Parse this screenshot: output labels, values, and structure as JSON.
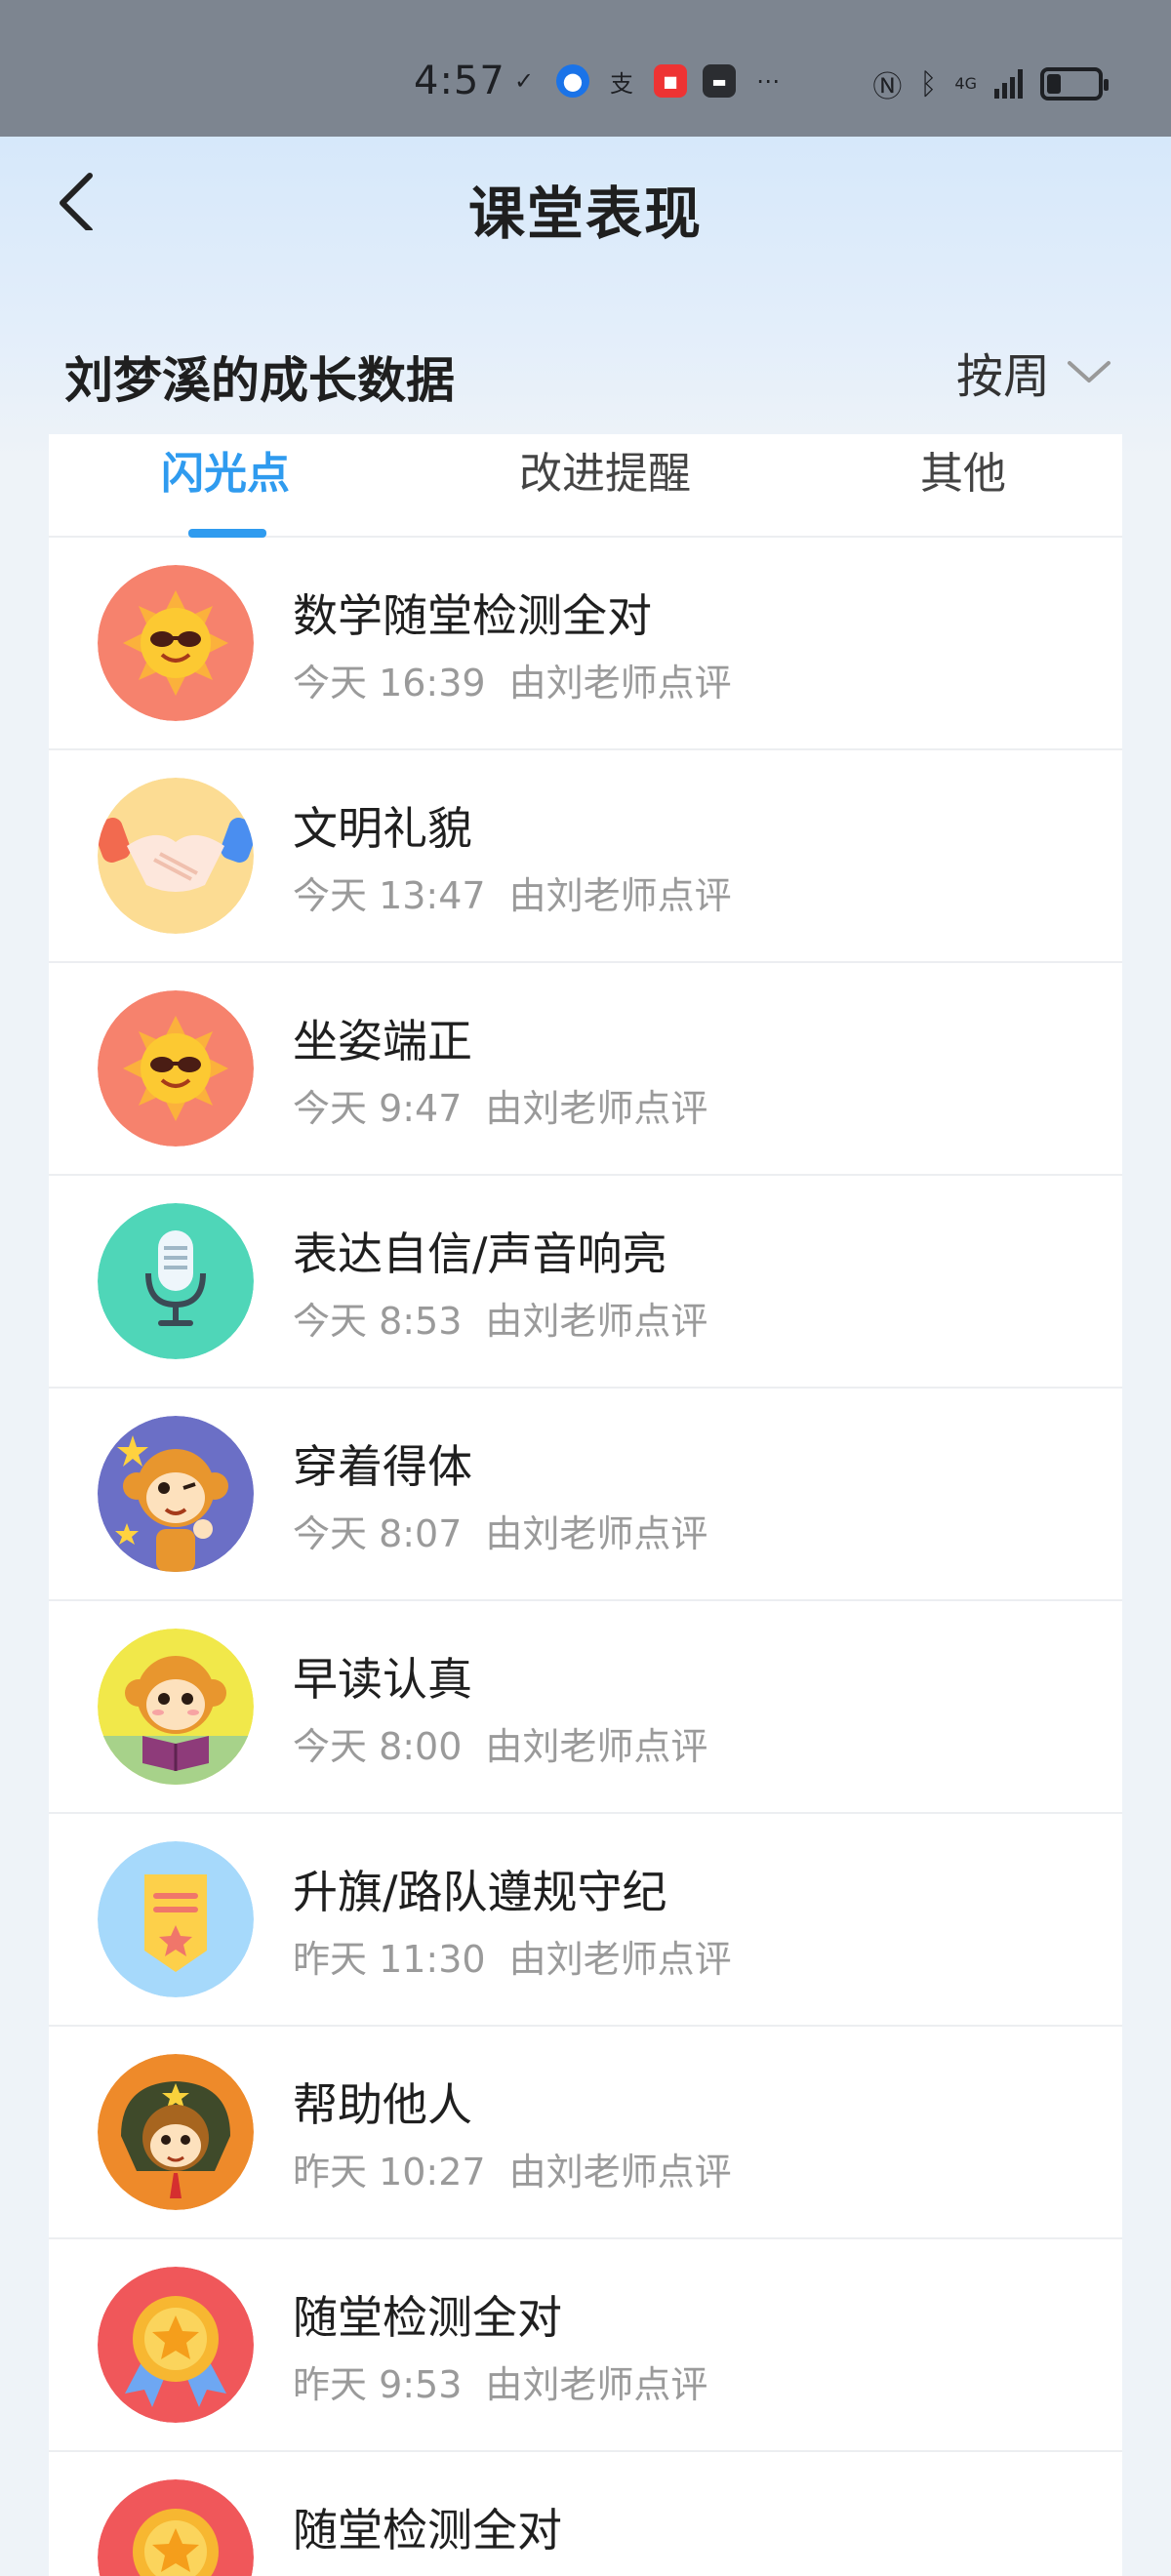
{
  "status_bar": {
    "time": "4:57",
    "network": "4G",
    "icons": [
      "double-check-icon",
      "browser-icon",
      "alipay-icon",
      "news-app-icon",
      "notes-app-icon",
      "more-icon",
      "nfc-icon",
      "bluetooth-icon",
      "signal-icon",
      "battery-icon"
    ]
  },
  "header": {
    "title": "课堂表现",
    "student_title": "刘梦溪的成长数据",
    "period": "按周"
  },
  "tabs": [
    {
      "label": "闪光点",
      "active": true
    },
    {
      "label": "改进提醒",
      "active": false
    },
    {
      "label": "其他",
      "active": false
    }
  ],
  "items": [
    {
      "title": "数学随堂检测全对",
      "time": "今天 16:39",
      "by": "由刘老师点评",
      "icon": "sun-sunglasses-icon"
    },
    {
      "title": "文明礼貌",
      "time": "今天 13:47",
      "by": "由刘老师点评",
      "icon": "handshake-icon"
    },
    {
      "title": "坐姿端正",
      "time": "今天 9:47",
      "by": "由刘老师点评",
      "icon": "sun-sunglasses-icon"
    },
    {
      "title": "表达自信/声音响亮",
      "time": "今天 8:53",
      "by": "由刘老师点评",
      "icon": "microphone-icon"
    },
    {
      "title": "穿着得体",
      "time": "今天 8:07",
      "by": "由刘老师点评",
      "icon": "monkey-thumbs-up-icon"
    },
    {
      "title": "早读认真",
      "time": "今天 8:00",
      "by": "由刘老师点评",
      "icon": "monkey-reading-icon"
    },
    {
      "title": "升旗/路队遵规守纪",
      "time": "昨天 11:30",
      "by": "由刘老师点评",
      "icon": "banner-star-icon"
    },
    {
      "title": "帮助他人",
      "time": "昨天 10:27",
      "by": "由刘老师点评",
      "icon": "monkey-hat-icon"
    },
    {
      "title": "随堂检测全对",
      "time": "昨天 9:53",
      "by": "由刘老师点评",
      "icon": "medal-icon"
    },
    {
      "title": "随堂检测全对",
      "time": "",
      "by": "",
      "icon": "medal-icon"
    }
  ],
  "colors": {
    "accent": "#2f9bef",
    "status_bar": "#7d8590",
    "header_gradient_top": "#d6e8fa"
  }
}
